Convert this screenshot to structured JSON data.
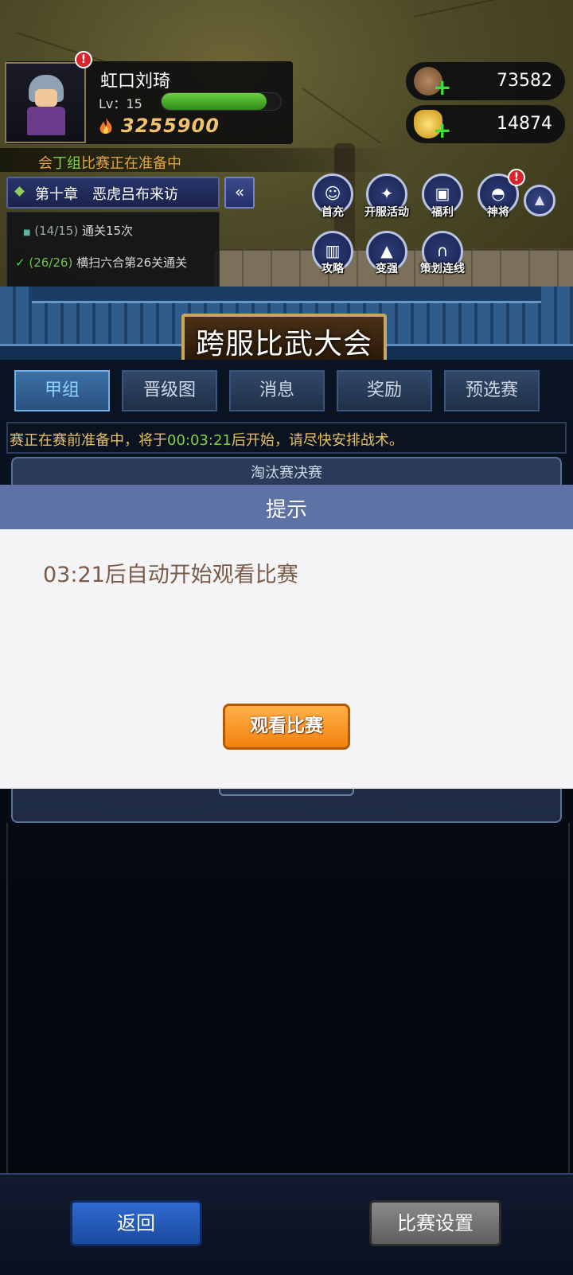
{
  "player": {
    "name": "虹口刘琦",
    "level_label": "Lv：15",
    "xp_fraction": 0.88,
    "combat_power": "3255900",
    "avatar_badge": "!"
  },
  "currencies": {
    "coins": {
      "value": "73582",
      "icon": "copper-coin-icon"
    },
    "ingots": {
      "value": "14874",
      "icon": "gold-ingot-icon"
    }
  },
  "ticker": {
    "prefix": "会",
    "group": "丁组",
    "suffix": "比赛正在准备中"
  },
  "quest": {
    "chapter": "第十章　恶虎吕布来访",
    "collapse_icon": "«",
    "items": [
      {
        "progress": "(14/15)",
        "text": "通关15次"
      },
      {
        "progress": "(26/26)",
        "text": "横扫六合第26关通关"
      }
    ]
  },
  "features": [
    {
      "label": "首充",
      "icon": "hero-portrait-icon"
    },
    {
      "label": "开服活动",
      "icon": "gift-icon"
    },
    {
      "label": "福利",
      "icon": "gift-box-icon"
    },
    {
      "label": "神将",
      "icon": "helmet-icon"
    },
    {
      "label": "攻略",
      "icon": "guide-book-icon"
    },
    {
      "label": "变强",
      "icon": "flame-up-icon"
    },
    {
      "label": "策划连线",
      "icon": "headset-icon"
    }
  ],
  "event": {
    "title": "跨服比武大会",
    "tabs": [
      "甲组",
      "晋级图",
      "消息",
      "奖励",
      "预选赛"
    ],
    "active_tab": 0,
    "notice_prefix": "赛正在赛前准备中，将于",
    "notice_time": "00:03:21",
    "notice_suffix": "后开始，请尽快安排战术。",
    "bracket_title": "淘汰赛决赛"
  },
  "dialog": {
    "title": "提示",
    "message": "03:21后自动开始观看比赛",
    "button": "观看比赛"
  },
  "footer": {
    "back": "返回",
    "settings": "比赛设置"
  }
}
